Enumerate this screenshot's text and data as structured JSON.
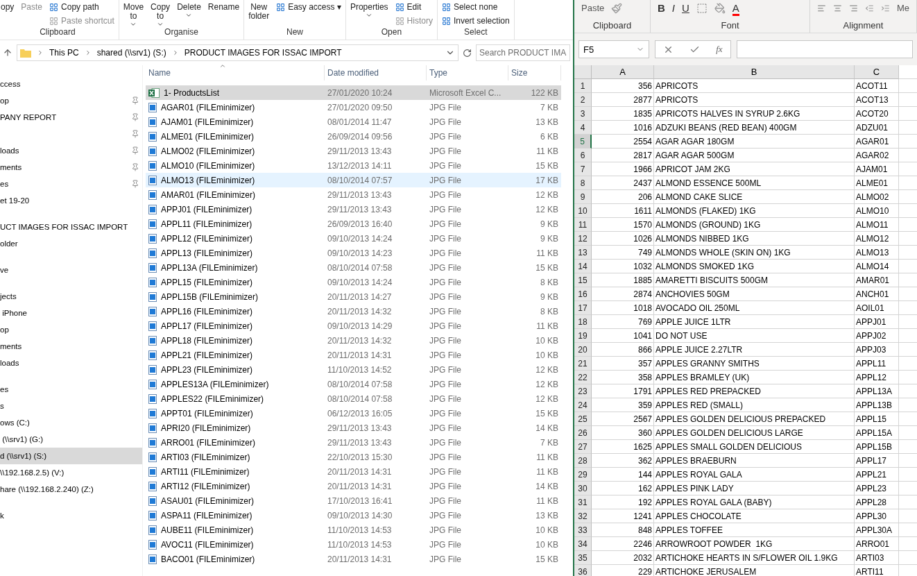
{
  "explorer": {
    "ribbon": [
      {
        "label": "Clipboard",
        "columns": [
          {
            "kind": "large",
            "label": "opy",
            "disabled": false,
            "dropdown": false
          },
          {
            "kind": "large",
            "label": "Paste",
            "disabled": true,
            "dropdown": false
          },
          {
            "kind": "stack",
            "items": [
              {
                "label": "Copy path",
                "disabled": false
              },
              {
                "label": "Paste shortcut",
                "disabled": true
              }
            ]
          }
        ]
      },
      {
        "label": "Organise",
        "columns": [
          {
            "kind": "large",
            "label": "Move to",
            "disabled": false,
            "dropdown": true
          },
          {
            "kind": "large",
            "label": "Copy to",
            "disabled": false,
            "dropdown": true
          },
          {
            "kind": "large",
            "label": "Delete",
            "disabled": false,
            "dropdown": true
          },
          {
            "kind": "large",
            "label": "Rename",
            "disabled": false,
            "dropdown": false
          }
        ]
      },
      {
        "label": "New",
        "columns": [
          {
            "kind": "large",
            "label": "New folder",
            "disabled": false,
            "dropdown": false
          },
          {
            "kind": "stack",
            "items": [
              {
                "label": "Easy access ▾",
                "disabled": false
              }
            ]
          }
        ]
      },
      {
        "label": "Open",
        "columns": [
          {
            "kind": "large",
            "label": "Properties",
            "disabled": false,
            "dropdown": true
          },
          {
            "kind": "stack",
            "items": [
              {
                "label": "Edit",
                "disabled": false
              },
              {
                "label": "History",
                "disabled": true
              }
            ]
          }
        ]
      },
      {
        "label": "Select",
        "columns": [
          {
            "kind": "stack",
            "items": [
              {
                "label": "Select none",
                "disabled": false
              },
              {
                "label": "Invert selection",
                "disabled": false
              }
            ]
          }
        ]
      }
    ],
    "breadcrumbs": [
      "This PC",
      "shared (\\\\srv1) (S:)",
      "PRODUCT IMAGES FOR ISSAC IMPORT"
    ],
    "search": {
      "placeholder": "Search PRODUCT IMA"
    },
    "sidebar": [
      [
        {
          "label": "ccess",
          "pinned": false,
          "selected": false
        },
        {
          "label": "op",
          "pinned": true,
          "selected": false
        },
        {
          "label": "PANY REPORT",
          "pinned": true,
          "selected": false
        },
        {
          "pinned": true,
          "selected": false
        },
        {
          "label": "loads",
          "pinned": true,
          "selected": false
        },
        {
          "label": "ments",
          "pinned": true,
          "selected": false
        },
        {
          "label": "es",
          "pinned": true,
          "selected": false
        },
        {
          "label": "et 19-20",
          "pinned": false,
          "selected": false
        }
      ],
      [
        {
          "label": "UCT IMAGES FOR ISSAC IMPORT",
          "pinned": false,
          "selected": false
        },
        {
          "label": "older",
          "pinned": false,
          "selected": false
        }
      ],
      [
        {
          "label": "ve",
          "pinned": false,
          "selected": false
        }
      ],
      [
        {
          "label": "jects",
          "pinned": false,
          "selected": false
        },
        {
          "label": " iPhone",
          "pinned": false,
          "selected": false
        },
        {
          "label": "op",
          "pinned": false,
          "selected": false
        },
        {
          "label": "ments",
          "pinned": false,
          "selected": false
        },
        {
          "label": "loads",
          "pinned": false,
          "selected": false
        }
      ],
      [
        {
          "label": "es",
          "pinned": false,
          "selected": false
        },
        {
          "label": "s",
          "pinned": false,
          "selected": false
        },
        {
          "label": "ows (C:)",
          "pinned": false,
          "selected": false
        },
        {
          "label": " (\\\\srv1) (G:)",
          "pinned": false,
          "selected": false
        },
        {
          "label": "d (\\\\srv1) (S:)",
          "pinned": false,
          "selected": true
        },
        {
          "label": "\\\\192.168.2.5) (V:)",
          "pinned": false,
          "selected": false
        },
        {
          "label": "hare (\\\\192.168.2.240) (Z:)",
          "pinned": false,
          "selected": false
        }
      ],
      [
        {
          "label": "k",
          "pinned": false,
          "selected": false
        }
      ]
    ],
    "columns": [
      "Name",
      "Date modified",
      "Type",
      "Size"
    ],
    "files": [
      {
        "kind": "excel",
        "name": "1- ProductsList",
        "date": "27/01/2020 10:24",
        "type": "Microsoft Excel C...",
        "size": "122 KB",
        "selected": true,
        "hot": false
      },
      {
        "kind": "image",
        "name": "AGAR01 (FILEminimizer)",
        "date": "27/01/2020 09:50",
        "type": "JPG File",
        "size": "7 KB",
        "selected": false,
        "hot": false
      },
      {
        "kind": "image",
        "name": "AJAM01 (FILEminimizer)",
        "date": "08/01/2014 11:47",
        "type": "JPG File",
        "size": "13 KB",
        "selected": false,
        "hot": false
      },
      {
        "kind": "image",
        "name": "ALME01 (FILEminimizer)",
        "date": "26/09/2014 09:56",
        "type": "JPG File",
        "size": "6 KB",
        "selected": false,
        "hot": false
      },
      {
        "kind": "image",
        "name": "ALMO02 (FILEminimizer)",
        "date": "29/11/2013 13:43",
        "type": "JPG File",
        "size": "11 KB",
        "selected": false,
        "hot": false
      },
      {
        "kind": "image",
        "name": "ALMO10 (FILEminimizer)",
        "date": "13/12/2013 14:11",
        "type": "JPG File",
        "size": "15 KB",
        "selected": false,
        "hot": false
      },
      {
        "kind": "image",
        "name": "ALMO13 (FILEminimizer)",
        "date": "08/10/2014 07:57",
        "type": "JPG File",
        "size": "17 KB",
        "selected": false,
        "hot": true
      },
      {
        "kind": "image",
        "name": "AMAR01 (FILEminimizer)",
        "date": "29/11/2013 13:43",
        "type": "JPG File",
        "size": "12 KB",
        "selected": false,
        "hot": false
      },
      {
        "kind": "image",
        "name": "APPJ01 (FILEminimizer)",
        "date": "29/11/2013 13:43",
        "type": "JPG File",
        "size": "12 KB",
        "selected": false,
        "hot": false
      },
      {
        "kind": "image",
        "name": "APPL11 (FILEminimizer)",
        "date": "26/09/2013 16:40",
        "type": "JPG File",
        "size": "9 KB",
        "selected": false,
        "hot": false
      },
      {
        "kind": "image",
        "name": "APPL12 (FILEminimizer)",
        "date": "09/10/2013 14:24",
        "type": "JPG File",
        "size": "9 KB",
        "selected": false,
        "hot": false
      },
      {
        "kind": "image",
        "name": "APPL13 (FILEminimizer)",
        "date": "09/10/2013 14:23",
        "type": "JPG File",
        "size": "11 KB",
        "selected": false,
        "hot": false
      },
      {
        "kind": "image",
        "name": "APPL13A (FILEminimizer)",
        "date": "08/10/2014 07:58",
        "type": "JPG File",
        "size": "15 KB",
        "selected": false,
        "hot": false
      },
      {
        "kind": "image",
        "name": "APPL15 (FILEminimizer)",
        "date": "09/10/2013 14:24",
        "type": "JPG File",
        "size": "8 KB",
        "selected": false,
        "hot": false
      },
      {
        "kind": "image",
        "name": "APPL15B (FILEminimizer)",
        "date": "20/11/2013 14:27",
        "type": "JPG File",
        "size": "9 KB",
        "selected": false,
        "hot": false
      },
      {
        "kind": "image",
        "name": "APPL16 (FILEminimizer)",
        "date": "20/11/2013 14:32",
        "type": "JPG File",
        "size": "8 KB",
        "selected": false,
        "hot": false
      },
      {
        "kind": "image",
        "name": "APPL17 (FILEminimizer)",
        "date": "09/10/2013 14:29",
        "type": "JPG File",
        "size": "11 KB",
        "selected": false,
        "hot": false
      },
      {
        "kind": "image",
        "name": "APPL18 (FILEminimizer)",
        "date": "20/11/2013 14:32",
        "type": "JPG File",
        "size": "10 KB",
        "selected": false,
        "hot": false
      },
      {
        "kind": "image",
        "name": "APPL21 (FILEminimizer)",
        "date": "20/11/2013 14:31",
        "type": "JPG File",
        "size": "10 KB",
        "selected": false,
        "hot": false
      },
      {
        "kind": "image",
        "name": "APPL23 (FILEminimizer)",
        "date": "11/10/2013 14:52",
        "type": "JPG File",
        "size": "12 KB",
        "selected": false,
        "hot": false
      },
      {
        "kind": "image",
        "name": "APPLES13A (FILEminimizer)",
        "date": "08/10/2014 07:58",
        "type": "JPG File",
        "size": "12 KB",
        "selected": false,
        "hot": false
      },
      {
        "kind": "image",
        "name": "APPLES22 (FILEminimizer)",
        "date": "08/10/2014 07:58",
        "type": "JPG File",
        "size": "12 KB",
        "selected": false,
        "hot": false
      },
      {
        "kind": "image",
        "name": "APPT01 (FILEminimizer)",
        "date": "06/12/2013 16:05",
        "type": "JPG File",
        "size": "15 KB",
        "selected": false,
        "hot": false
      },
      {
        "kind": "image",
        "name": "APRI20 (FILEminimizer)",
        "date": "29/11/2013 13:43",
        "type": "JPG File",
        "size": "14 KB",
        "selected": false,
        "hot": false
      },
      {
        "kind": "image",
        "name": "ARRO01 (FILEminimizer)",
        "date": "29/11/2013 13:43",
        "type": "JPG File",
        "size": "7 KB",
        "selected": false,
        "hot": false
      },
      {
        "kind": "image",
        "name": "ARTI03 (FILEminimizer)",
        "date": "22/10/2013 15:30",
        "type": "JPG File",
        "size": "11 KB",
        "selected": false,
        "hot": false
      },
      {
        "kind": "image",
        "name": "ARTI11 (FILEminimizer)",
        "date": "20/11/2013 14:31",
        "type": "JPG File",
        "size": "11 KB",
        "selected": false,
        "hot": false
      },
      {
        "kind": "image",
        "name": "ARTI12 (FILEminimizer)",
        "date": "20/11/2013 14:31",
        "type": "JPG File",
        "size": "14 KB",
        "selected": false,
        "hot": false
      },
      {
        "kind": "image",
        "name": "ASAU01 (FILEminimizer)",
        "date": "17/10/2013 16:41",
        "type": "JPG File",
        "size": "11 KB",
        "selected": false,
        "hot": false
      },
      {
        "kind": "image",
        "name": "ASPA11 (FILEminimizer)",
        "date": "09/10/2013 14:30",
        "type": "JPG File",
        "size": "13 KB",
        "selected": false,
        "hot": false
      },
      {
        "kind": "image",
        "name": "AUBE11 (FILEminimizer)",
        "date": "11/10/2013 14:53",
        "type": "JPG File",
        "size": "10 KB",
        "selected": false,
        "hot": false
      },
      {
        "kind": "image",
        "name": "AVOC11 (FILEminimizer)",
        "date": "11/10/2013 14:53",
        "type": "JPG File",
        "size": "10 KB",
        "selected": false,
        "hot": false
      },
      {
        "kind": "image",
        "name": "BACO01 (FILEminimizer)",
        "date": "20/11/2013 14:31",
        "type": "JPG File",
        "size": "15 KB",
        "selected": false,
        "hot": false
      }
    ]
  },
  "excel": {
    "ribbon": [
      {
        "label": "Clipboard",
        "items": [
          {
            "kind": "text",
            "label": "Paste"
          },
          {
            "kind": "brush"
          }
        ]
      },
      {
        "label": "Font",
        "items": [
          {
            "kind": "bold",
            "label": "B"
          },
          {
            "kind": "italic",
            "label": "I"
          },
          {
            "kind": "underline",
            "label": "U"
          },
          {
            "kind": "borders"
          },
          {
            "kind": "fill"
          },
          {
            "kind": "fontcolor",
            "label": "A"
          }
        ]
      },
      {
        "label": "Alignment",
        "items": [
          {
            "kind": "align"
          },
          {
            "kind": "indent"
          },
          {
            "kind": "text",
            "label": "Me"
          }
        ]
      }
    ],
    "name_box": "F5",
    "function_label": "fx",
    "columns": [
      "A",
      "B",
      "C"
    ],
    "rows": [
      {
        "num": "1",
        "a": "356",
        "b": "APRICOTS",
        "c": "ACOT11",
        "selected": false
      },
      {
        "num": "2",
        "a": "2877",
        "b": "APRICOTS",
        "c": "ACOT13",
        "selected": false
      },
      {
        "num": "3",
        "a": "1835",
        "b": "APRICOTS HALVES IN SYRUP 2.6KG",
        "c": "ACOT20",
        "selected": false
      },
      {
        "num": "4",
        "a": "1016",
        "b": "ADZUKI BEANS (RED BEAN) 400GM",
        "c": "ADZU01",
        "selected": false
      },
      {
        "num": "5",
        "a": "2554",
        "b": "AGAR AGAR 180GM",
        "c": "AGAR01",
        "selected": true
      },
      {
        "num": "6",
        "a": "2817",
        "b": "AGAR AGAR 500GM",
        "c": "AGAR02",
        "selected": false
      },
      {
        "num": "7",
        "a": "1966",
        "b": "APRICOT JAM 2KG",
        "c": "AJAM01",
        "selected": false
      },
      {
        "num": "8",
        "a": "2437",
        "b": "ALMOND ESSENCE 500ML",
        "c": "ALME01",
        "selected": false
      },
      {
        "num": "9",
        "a": "206",
        "b": "ALMOND CAKE SLICE",
        "c": "ALMO02",
        "selected": false
      },
      {
        "num": "10",
        "a": "1611",
        "b": "ALMONDS (FLAKED) 1KG",
        "c": "ALMO10",
        "selected": false
      },
      {
        "num": "11",
        "a": "1570",
        "b": "ALMONDS (GROUND) 1KG",
        "c": "ALMO11",
        "selected": false
      },
      {
        "num": "12",
        "a": "1026",
        "b": "ALMONDS NIBBED 1KG",
        "c": "ALMO12",
        "selected": false
      },
      {
        "num": "13",
        "a": "749",
        "b": "ALMONDS WHOLE (SKIN ON) 1KG",
        "c": "ALMO13",
        "selected": false
      },
      {
        "num": "14",
        "a": "1032",
        "b": "ALMONDS SMOKED 1KG",
        "c": "ALMO14",
        "selected": false
      },
      {
        "num": "15",
        "a": "1885",
        "b": "AMARETTI BISCUITS 500GM",
        "c": "AMAR01",
        "selected": false
      },
      {
        "num": "16",
        "a": "2874",
        "b": "ANCHOVIES 50GM",
        "c": "ANCH01",
        "selected": false
      },
      {
        "num": "17",
        "a": "1018",
        "b": "AVOCADO OIL 250ML",
        "c": "AOIL01",
        "selected": false
      },
      {
        "num": "18",
        "a": "769",
        "b": "APPLE JUICE 1LTR",
        "c": "APPJ01",
        "selected": false
      },
      {
        "num": "19",
        "a": "1041",
        "b": "DO NOT USE",
        "c": "APPJ02",
        "selected": false
      },
      {
        "num": "20",
        "a": "866",
        "b": "APPLE JUICE 2.27LTR",
        "c": "APPJ03",
        "selected": false
      },
      {
        "num": "21",
        "a": "357",
        "b": "APPLES GRANNY SMITHS",
        "c": "APPL11",
        "selected": false
      },
      {
        "num": "22",
        "a": "358",
        "b": "APPLES BRAMLEY (UK)",
        "c": "APPL12",
        "selected": false
      },
      {
        "num": "23",
        "a": "1791",
        "b": "APPLES RED PREPACKED",
        "c": "APPL13A",
        "selected": false
      },
      {
        "num": "24",
        "a": "359",
        "b": "APPLES RED (SMALL)",
        "c": "APPL13B",
        "selected": false
      },
      {
        "num": "25",
        "a": "2567",
        "b": "APPLES GOLDEN DELICIOUS PREPACKED",
        "c": "APPL15",
        "selected": false
      },
      {
        "num": "26",
        "a": "360",
        "b": "APPLES GOLDEN DELICIOUS LARGE",
        "c": "APPL15A",
        "selected": false
      },
      {
        "num": "27",
        "a": "1625",
        "b": "APPLES SMALL GOLDEN DELICIOUS",
        "c": "APPL15B",
        "selected": false
      },
      {
        "num": "28",
        "a": "362",
        "b": "APPLES BRAEBURN",
        "c": "APPL17",
        "selected": false
      },
      {
        "num": "29",
        "a": "144",
        "b": "APPLES ROYAL GALA",
        "c": "APPL21",
        "selected": false
      },
      {
        "num": "30",
        "a": "162",
        "b": "APPLES PINK LADY",
        "c": "APPL23",
        "selected": false
      },
      {
        "num": "31",
        "a": "192",
        "b": "APPLES ROYAL GALA (BABY)",
        "c": "APPL28",
        "selected": false
      },
      {
        "num": "32",
        "a": "1241",
        "b": "APPLES CHOCOLATE",
        "c": "APPL30",
        "selected": false
      },
      {
        "num": "33",
        "a": "848",
        "b": "APPLES TOFFEE",
        "c": "APPL30A",
        "selected": false
      },
      {
        "num": "34",
        "a": "2246",
        "b": "ARROWROOT POWDER  1KG",
        "c": "ARRO01",
        "selected": false
      },
      {
        "num": "35",
        "a": "2032",
        "b": "ARTICHOKE HEARTS IN S/FLOWER OIL 1.9KG",
        "c": "ARTI03",
        "selected": false
      },
      {
        "num": "36",
        "a": "229",
        "b": "ARTICHOKE JERUSALEM",
        "c": "ARTI11",
        "selected": false
      }
    ]
  }
}
